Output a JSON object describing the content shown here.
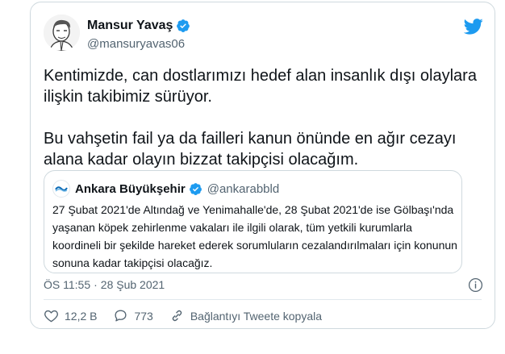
{
  "tweet": {
    "author_name": "Mansur Yavaş",
    "author_handle": "@mansuryavas06",
    "paragraphs": [
      "Kentimizde, can dostlarımızı hedef alan insanlık dışı olaylara ilişkin takibimiz sürüyor.",
      "Bu vahşetin fail ya da failleri kanun önünde en ağır cezayı alana kadar olayın bizzat takipçisi olacağım."
    ],
    "time": "ÖS 11:55",
    "separator": "·",
    "date": "28 Şub 2021"
  },
  "quoted": {
    "author_name": "Ankara Büyükşehir",
    "author_handle": "@ankarabbld",
    "text": "27 Şubat 2021'de Altındağ ve Yenimahalle'de, 28 Şubat 2021'de ise Gölbaşı'nda yaşanan köpek zehirlenme vakaları ile ilgili olarak, tüm yetkili kurumlarla koordineli bir şekilde hareket ederek sorumluların cezalandırılmaları için konunun sonuna kadar takipçisi olacağız."
  },
  "actions": {
    "likes": "12,2 B",
    "replies": "773",
    "copy_link": "Bağlantıyı Tweete kopyala"
  },
  "colors": {
    "twitter_blue": "#1d9bf0",
    "text_primary": "#0f1419",
    "text_secondary": "#536471",
    "border": "#cfd9de"
  },
  "icons": [
    "avatar",
    "verified-badge-icon",
    "twitter-bird-icon",
    "info-icon",
    "heart-icon",
    "reply-icon",
    "link-icon"
  ]
}
